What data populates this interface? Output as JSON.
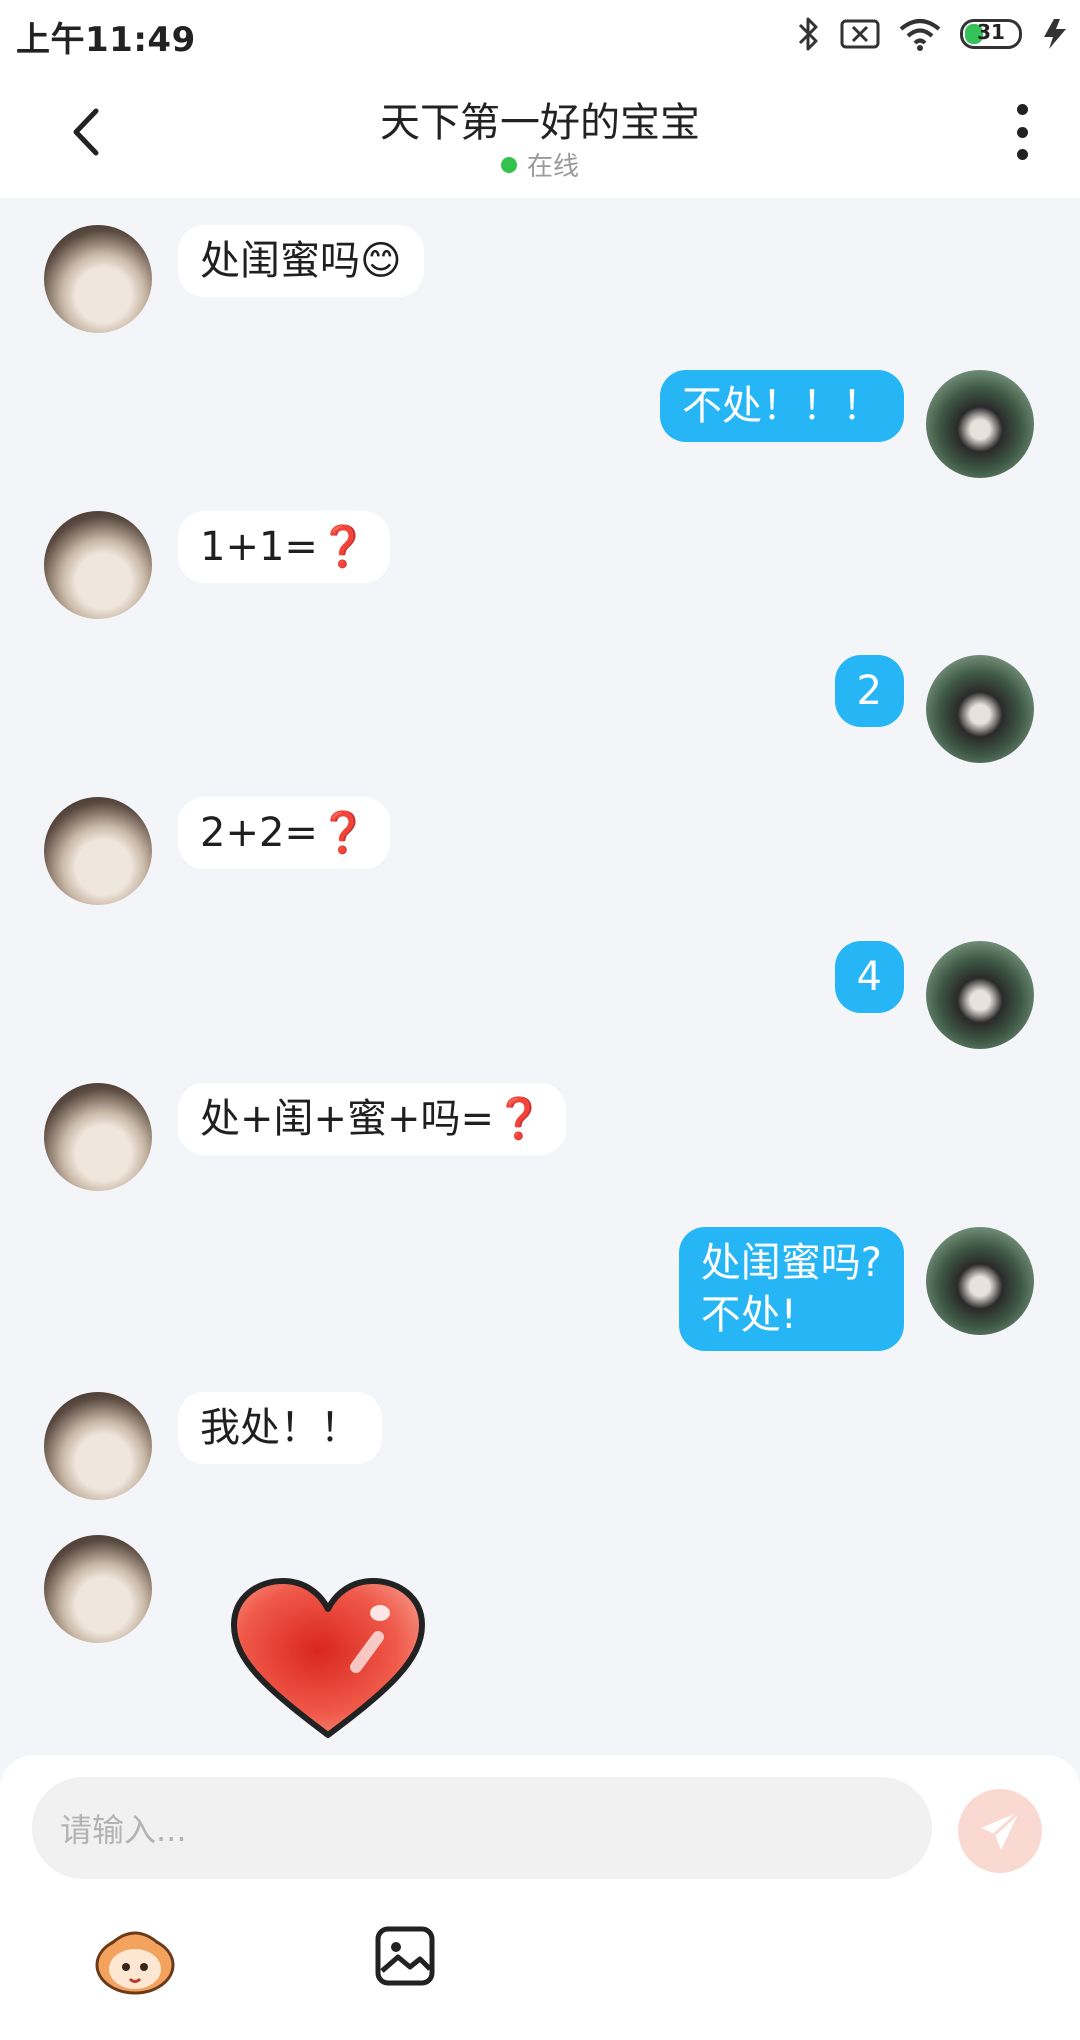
{
  "status_bar": {
    "time": "上午11:49",
    "battery": "31",
    "icons": [
      "bluetooth-icon",
      "no-sim-icon",
      "wifi-icon",
      "battery-icon",
      "charging-icon"
    ]
  },
  "header": {
    "title": "天下第一好的宝宝",
    "status": "在线",
    "status_color": "#33c24d",
    "back_icon": "chevron-left-icon",
    "more_icon": "more-vertical-icon"
  },
  "messages": [
    {
      "side": "in",
      "text": "处闺蜜吗",
      "emoji": "😊"
    },
    {
      "side": "out",
      "text": "不处！！！"
    },
    {
      "side": "in",
      "text": "1+1=",
      "emoji": "❓"
    },
    {
      "side": "out",
      "text": "2"
    },
    {
      "side": "in",
      "text": "2+2=",
      "emoji": "❓"
    },
    {
      "side": "out",
      "text": "4"
    },
    {
      "side": "in",
      "text": "处+闺+蜜+吗=",
      "emoji": "❓"
    },
    {
      "side": "out",
      "text": "处闺蜜吗?\n不处!"
    },
    {
      "side": "in",
      "text": "我处！！"
    },
    {
      "side": "in",
      "sticker": "red-heart-sticker"
    }
  ],
  "colors": {
    "outgoing_bubble": "#26b6f5",
    "incoming_bubble": "#ffffff",
    "background": "#f3f5f8"
  },
  "composer": {
    "placeholder": "请输入...",
    "send_icon": "paper-plane-icon",
    "tools": [
      "mascot-emoji-icon",
      "image-icon"
    ]
  }
}
